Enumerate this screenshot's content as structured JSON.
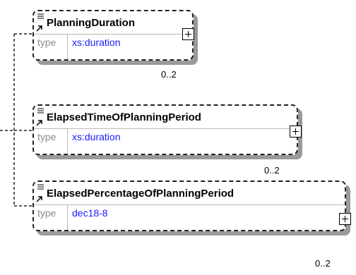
{
  "elements": [
    {
      "name": "PlanningDuration",
      "type_label": "type",
      "type_value": "xs:duration",
      "cardinality": "0..2"
    },
    {
      "name": "ElapsedTimeOfPlanningPeriod",
      "type_label": "type",
      "type_value": "xs:duration",
      "cardinality": "0..2"
    },
    {
      "name": "ElapsedPercentageOfPlanningPeriod",
      "type_label": "type",
      "type_value": "dec18-8",
      "cardinality": "0..2"
    }
  ],
  "colors": {
    "type_value": "#1a1aff",
    "type_label": "#8c8c8c",
    "border": "#222222",
    "shadow": "#9a9a9a"
  },
  "icons": [
    "documentation-icon",
    "optional-element-icon",
    "expand-icon"
  ]
}
